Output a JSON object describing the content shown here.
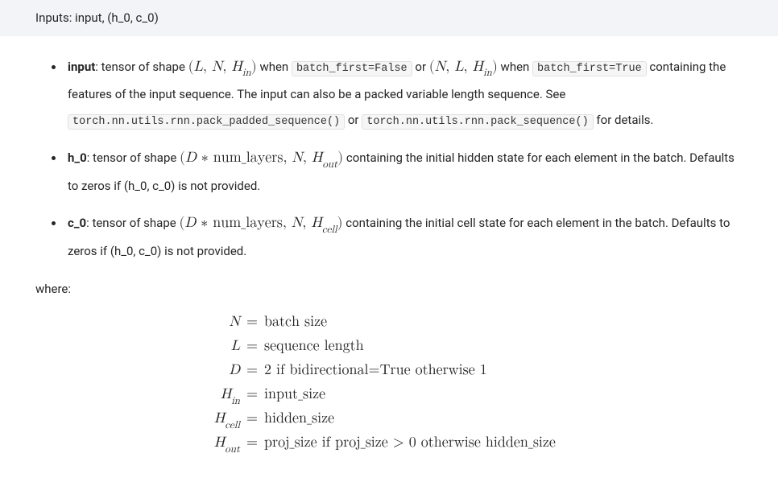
{
  "header": {
    "title": "Inputs: input, (h_0, c_0)"
  },
  "params": {
    "input": {
      "name": "input",
      "pre": ": tensor of shape ",
      "shape1": "(L, N, H_in)",
      "mid1": " when ",
      "code1": "batch_first=False",
      "between": " or ",
      "shape2": "(N, L, H_in)",
      "mid2": " when ",
      "code2": "batch_first=True",
      "post": " containing the features of the input sequence. The input can also be a packed variable length sequence. See ",
      "code3": "torch.nn.utils.rnn.pack_padded_sequence()",
      "or_word": " or ",
      "code4": "torch.nn.utils.rnn.pack_sequence()",
      "tail": " for details."
    },
    "h0": {
      "name": "h_0",
      "pre": ": tensor of shape ",
      "shape": "(D * num_layers, N, H_out)",
      "post": " containing the initial hidden state for each element in the batch. Defaults to zeros if (h_0, c_0) is not provided."
    },
    "c0": {
      "name": "c_0",
      "pre": ": tensor of shape ",
      "shape": "(D * num_layers, N, H_cell)",
      "post": " containing the initial cell state for each element in the batch. Defaults to zeros if (h_0, c_0) is not provided."
    }
  },
  "where_label": "where:",
  "defs": {
    "N": {
      "lhs": "N",
      "rhs": "batch size"
    },
    "L": {
      "lhs": "L",
      "rhs": "sequence length"
    },
    "D": {
      "lhs": "D",
      "rhs": "2 if bidirectional=True otherwise 1"
    },
    "Hin": {
      "lhs": "H_in",
      "rhs": "input_size"
    },
    "Hcell": {
      "lhs": "H_cell",
      "rhs": "hidden_size"
    },
    "Hout": {
      "lhs": "H_out",
      "rhs": "proj_size if proj_size > 0 otherwise hidden_size"
    }
  }
}
